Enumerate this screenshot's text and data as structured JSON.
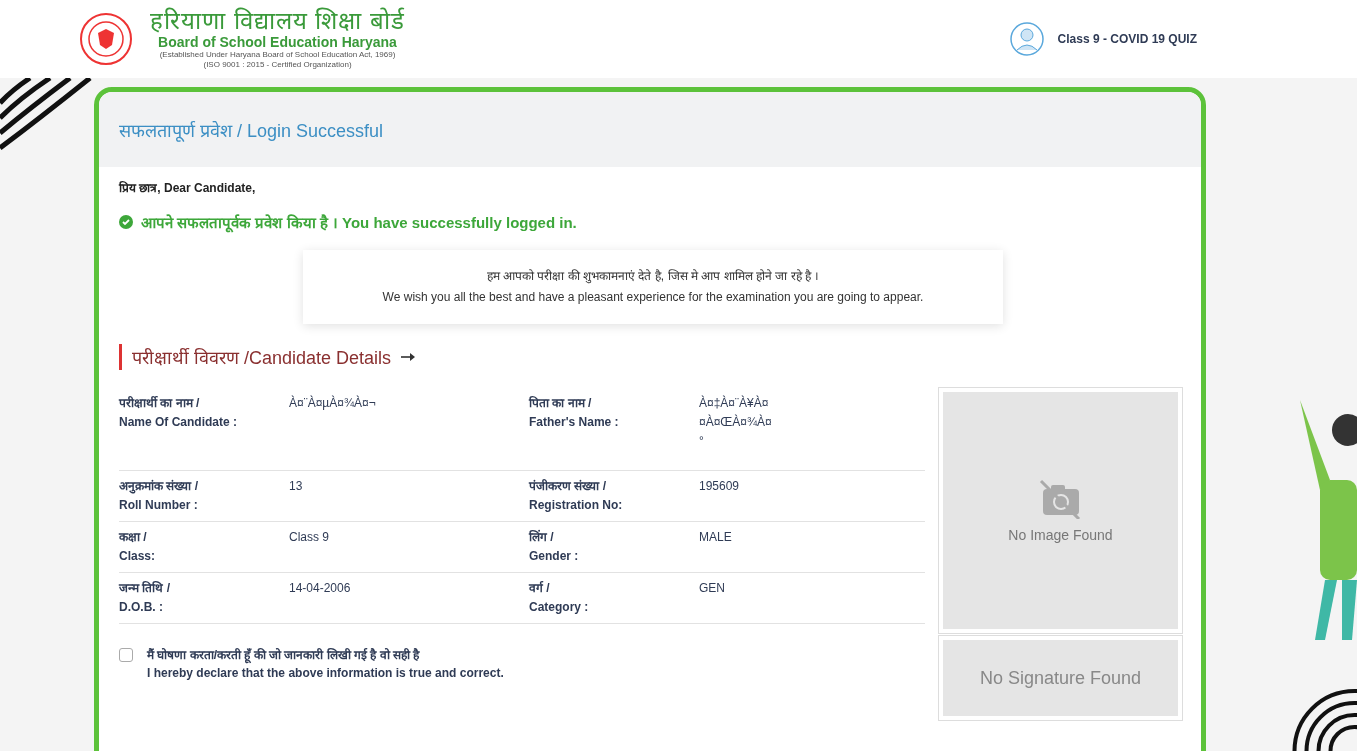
{
  "header": {
    "title_hindi": "हरियाणा विद्यालय शिक्षा बोर्ड",
    "title_english": "Board of School Education Haryana",
    "established": "(Established Under Haryana Board of School Education Act, 1969)",
    "iso": "(ISO 9001 : 2015 - Certified Organization)",
    "user_label": "Class 9 - COVID 19 QUIZ"
  },
  "card": {
    "title": "सफलतापूर्ण प्रवेश / Login Successful",
    "greeting": "प्रिय छात्र, Dear Candidate,",
    "success_message": "आपने सफलतापूर्वक प्रवेश किया है । You have successfully logged in.",
    "wishes": [
      "हम आपको परीक्षा की शुभकामनाएं देते है, जिस मे आप शामिल होने जा रहे है ।",
      "We wish you all the best and have a pleasant experience for the examination you are going to appear."
    ],
    "section_title": "परीक्षार्थी विवरण /Candidate Details",
    "details": [
      {
        "cells": [
          {
            "label_hindi": "परीक्षार्थी का नाम /",
            "label_english": "Name Of Candidate :",
            "value_lines": [
              "À¤¨À¤µÀ¤¾À¤¬"
            ]
          },
          {
            "label_hindi": "पिता का नाम /",
            "label_english": "Father's Name :",
            "value_lines": [
              "À¤‡À¤¨À¥À¤",
              "¤À¤ŒÀ¤¾À¤",
              "°"
            ]
          }
        ]
      },
      {
        "cells": [
          {
            "label_hindi": "अनुक्रमांक संख्या /",
            "label_english": "Roll Number :",
            "value_lines": [
              "13"
            ]
          },
          {
            "label_hindi": "पंजीकरण संख्या /",
            "label_english": "Registration No:",
            "value_lines": [
              "195609"
            ]
          }
        ]
      },
      {
        "cells": [
          {
            "label_hindi": "कक्षा /",
            "label_english": "Class:",
            "value_lines": [
              "Class 9"
            ]
          },
          {
            "label_hindi": "लिंग /",
            "label_english": "Gender :",
            "value_lines": [
              "MALE"
            ]
          }
        ]
      },
      {
        "cells": [
          {
            "label_hindi": "जन्म तिथि /",
            "label_english": "D.O.B. :",
            "value_lines": [
              "14-04-2006"
            ]
          },
          {
            "label_hindi": "वर्ग /",
            "label_english": "Category :",
            "value_lines": [
              "GEN"
            ]
          }
        ]
      }
    ],
    "photo": {
      "text": "No Image Found"
    },
    "signature": {
      "text": "No Signature Found"
    },
    "declaration": {
      "checked": false,
      "text_hindi": "मैं घोषणा करता/करती हूँ की जो जानकारी लिखी गई है वो सही है",
      "text_english": "I hereby declare that the above information is true and correct."
    }
  }
}
